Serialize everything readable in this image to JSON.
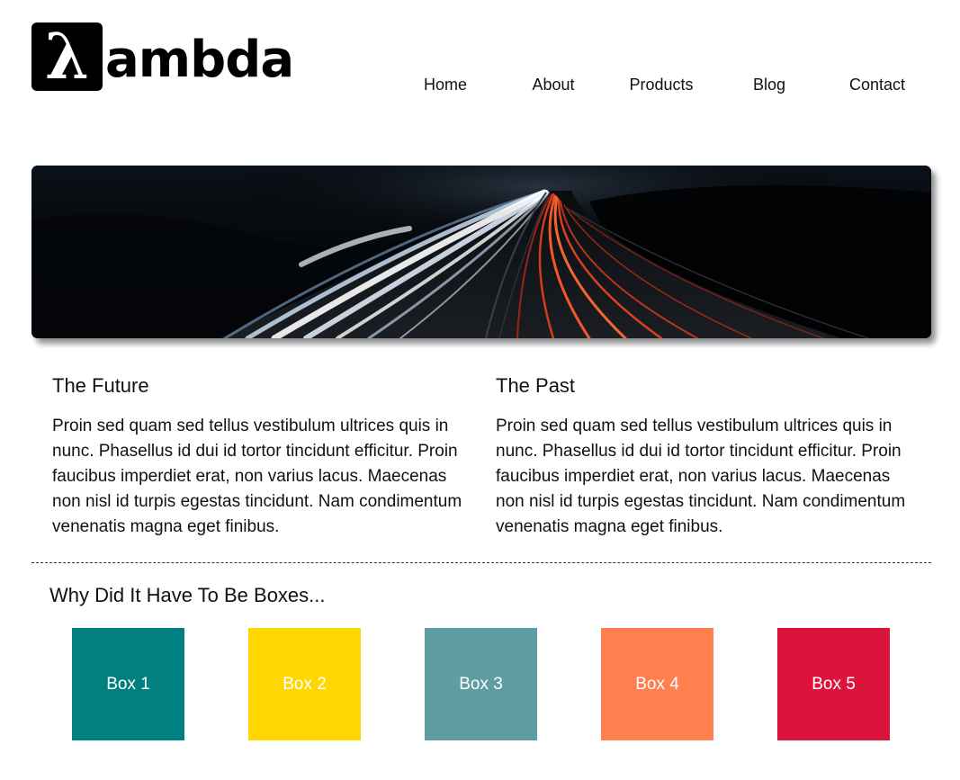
{
  "header": {
    "logo": {
      "glyph": "λ",
      "text": "ambda"
    },
    "nav": [
      "Home",
      "About",
      "Products",
      "Blog",
      "Contact"
    ]
  },
  "hero": {
    "image": "night-highway-light-trails"
  },
  "columns": [
    {
      "title": "The Future",
      "body": "Proin sed quam sed tellus vestibulum ultrices quis in nunc. Phasellus id dui id tortor tincidunt efficitur. Proin faucibus imperdiet erat, non varius lacus. Maecenas non nisl id turpis egestas tincidunt. Nam condimentum venenatis magna eget finibus."
    },
    {
      "title": "The Past",
      "body": "Proin sed quam sed tellus vestibulum ultrices quis in nunc. Phasellus id dui id tortor tincidunt efficitur. Proin faucibus imperdiet erat, non varius lacus. Maecenas non nisl id turpis egestas tincidunt. Nam condimentum venenatis magna eget finibus."
    }
  ],
  "boxes_section": {
    "title": "Why Did It Have To Be Boxes...",
    "boxes": [
      {
        "label": "Box 1",
        "color": "#008080"
      },
      {
        "label": "Box 2",
        "color": "#FFD700"
      },
      {
        "label": "Box 3",
        "color": "#5F9EA0"
      },
      {
        "label": "Box 4",
        "color": "#FF7F50"
      },
      {
        "label": "Box 5",
        "color": "#DC143C"
      }
    ]
  }
}
